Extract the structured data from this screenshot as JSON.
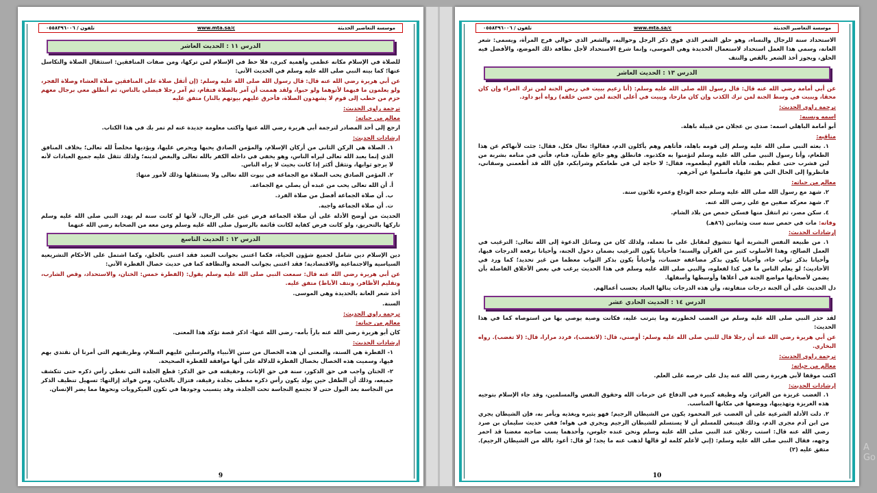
{
  "pages": {
    "left": {
      "header": {
        "org": "موسسة التعاضير الحديثة",
        "url": "www.mta.sa/c",
        "phone": "تلفون / ٠٥٥٨٣٩٦٠٠٦"
      },
      "page_number": "9",
      "lesson11": {
        "title": "الدرس ١١ : الحديث العاشر",
        "intro": "للصلاة في الإسلام مكانه عظمى وأهمية كبرى، فلا حظ في الإسلام لمن تركها، ومن صفات المنافقين: استثقال الصلاة والتكاسل عنها؛ كما بينه النبي صلى الله عليه وسلم في الحديث الآتي:",
        "hadith": "عن أبي هريرة رضي الله عنه قال: قال رسول الله صلى الله عليه وسلم: (إن أثقل صلاة على المنافقين صلاة العشاء وصلاة الفجر، ولو يعلمون ما فيهما لأتوهما ولو حبوا، ولقد هممت أن آمر بالصلاة فتقام، ثم آمر رجلا فيصلي بالناس، ثم أنطلق معي برجال معهم حزم من حطب إلى قوم لا يشهدون الصلاة، فأحرق عليهم بيوتهم بالنار) متفق عليه",
        "h_narrator": "ترجمة راوي الحديث:",
        "h_features": "معالم من حياته:",
        "features_text": "ارجع إلى أحد المصادر لترجمة أبي هريرة رضي الله عنها واكتب معلومة جديدة عنه لم تمر بك في هذا الكتاب.",
        "h_guidance": "إرشادات الحديث:",
        "g1": "١. الصلاة هي الركن الثاني من أركان الإسلام، والمؤمن الصادق يحبها ويحرص عليها، ويؤديها مخلصاً لله تعالى؛ بخلاف المنافق الذي إنما يعبد الله تعالى ليراه الناس، وهو يخفي في داخله الكفر بالله تعالى والبغض لدينه؛ ولذلك تثقل عليه جميع العبادات لأنه لا يرجو ثوابها، وتثقل أكثر إذا كانت بحيث لا يراه الناس.",
        "g2": "٢. المؤمن الصادق يحب الصلاة مع الجماعة في بيوت الله تعالى ولا يستثقلها وذلك لأمور منها:",
        "g2a": "أ. أن الله تعالى يحب من عبده أن يصلي مع الجماعة.",
        "g2b": "ب. أن صلاة الجماعة أفضل من صلاة الفرد.",
        "g2c": "ت. أن صلاة الجماعة واجبة.",
        "closing": "الحديث من أوضح الأدلة على أن صلاة الجماعة فرض عين على الرجال، لأنها لو كانت سنة لم يهدد النبي صلى الله عليه وسلم تاركها بالتحريق، ولو كانت فرض كفاية لكانت قائمة بالرسول صلى الله عليه وسلم ومن معه من الصحابة رضي الله عنهما"
      },
      "lesson12": {
        "title": "الدرس ١٢ : الحديث التاسع",
        "intro": "دين الإسلام دين شامل لجميع شؤون الحياة، فكما اعتنى بجوانب التعبد فقد اعتنى بالخلق، وكما اشتمل على الأحكام التشريعية السياسية والاجتماعية والاقتصادية؛ فقد اعتنى بجوانب الصحة والنظافة كما في حديث خصال الفطرة الآتي:",
        "hadith": "عن أبي هريرة رضي الله عنه قال: سمعت النبي صلى الله عليه وسلم يقول: (الفطرة خمس: الختان، والاستحداد، وقص الشارب، وتقليم الأظافر، ونتف الآباط) متفق عليه.",
        "def1": "أخذ شعر العانة بالحديدة وهي الموسى.",
        "def2": "السنة.",
        "h_narrator": "ترجمة راوي الحديث:",
        "h_features": "معالم من حياته:",
        "features_text": "كان أبو هريرة رضي الله عنه باراً بأمه- رضي الله عنها- اذكر قصة تؤكد هذا المعنى.",
        "h_guidance": "إرشادات الحديث:",
        "g1": "١- الفطرة هي السنة، والمعنى أن هذه الخصال من سنن الأنبياء والمرسلين عليهم السلام، وطريقتهم التي أمرنا أن نقتدي بهم فيها، وسميت هذه الخصال بخصال الفطرة للدلالة على أنها موافقة للفطرة الصحيحة.",
        "g2": "٢- الختان واجب في حق الذكور، سنة في حق الإناث، وحقيقته في حق الذكر: قطع الجلدة التي تغطي رأس ذكره حتى تتكشف جميعه، وذلك أن الطفل حين يولد يكون رأس ذكره مغطى بجلدة رقيقة، فتزال بالختان، ومن فوائد إزالتها: تسهيل تنظيف الذكر من النجاسة بعد البول حتى لا تجتمع النجاسة تحت الجلدة، وقد يتسبب وجودها في تكون الميكروبات ونحوها مما يضر الإنسان."
      }
    },
    "right": {
      "header": {
        "org": "موسسة التعاضير الحديثة",
        "url": "www.mta.sa/c",
        "phone": "تلفون / ٠٥٥٨٣٩٦٠٠٦"
      },
      "page_number": "10",
      "top_text": "الاستحداد سنة للرجال والنساء، وهو حلق الشعر الذي فوق ذكر الرجل وحواليه، والشعر الذي حوالي فرج المرأة، ويسمى: شعر العانة، وسمي هذا العمل استحداد لاستعمال الحديدة وهي الموسى، وإنما شرع الاستحداد لأجل نظافة ذلك الموضع، والأفضل فيه الحلق، ويجوز أخذ الشعر بالقص والنتف",
      "lesson13": {
        "title": "الدرس ١٣ : الحديث العاشر",
        "hadith": "عن أبي أمامة رضي الله عنه قال: قال رسول الله صلى الله عليه وسلم: (أنا زعيم ببيت في ربض الجنة لمن ترك المراء وإن كان محقا، وببيت في وسط الجنة لمن ترك الكذب وإن كان مازحا، وببيت في أعلى الجنة لمن حسن خلقه) رواه أبو داود.",
        "h_narrator": "ترجمة راوي الحديث:",
        "name_label": "اسمه ونسبه:",
        "name_text": "أبو أمامة الباهلي اسمه: صدي بن عجلان من قبيلة باهلة.",
        "virtues_label": "مناقبه:",
        "v1": "١. بعثه النبي صلى الله عليه وسلم إلى قومه باهلة، فأتاهم وهم يأكلون الدم، فقالوا: تعال فكل، فقال: جئت لأنهاكم عن هذا الطعام، وأنا رسول النبي صلى الله عليه وسلم لتؤمنوا به فكذبوه. فانطلق وهو جائع ظمآن، فنام، فأتي في منامه بشربة من لبن فشرب حتى عظم بطنه، فأتاه القوم ليطعموه، فقال: لا حاجة لي في طعامكم وشرابكم، فإن الله قد أطعمني وسقاني، فانظروا إلى الحال التي هو عليها، فأسلموا عن آخرهم.",
        "h_features": "معالم من حياته:",
        "v2": "٢. شهد مع رسول الله صلى الله عليه وسلم حجة الوداع وعمره ثلاثون سنة.",
        "v3": "٣. شهد معركة صفين مع علي رضي الله عنه.",
        "v4": "٤. سكن مصر، ثم انتقل منها فسكن حمص من بلاد الشام.",
        "death_label": "وفاته:",
        "death_text": "مات في حمص سنة ست وثمانين (٨٦هـ)",
        "h_guidance": "إرشادات الحديث:",
        "g1": "١. من طبيعة النفس البشرية أنها تتشوق لمقابل على ما تعمله، ولذلك كان من وسائل الدعوة إلى الله تعالى: الترغيب في العمل الصالح، وهذا الأسلوب كثير من القرآن والسنة؛ فأحيانا يكون الترغيب بضمان دخول الجنة، وأحيانا برفعة الدرجات فيها، وأحيانا بذكر ثواب خاء، وأحيانا يكون بذكر مضاعفة حسنات، وأحياناً يكون بذكر الثواب معظما من غير تحديد؛ كما ورد في الأحاديث؛ لو يعلم الناس ما في كذا لفعلوه، والنبي صلى الله عليه وسلم في هذا الحديث يرغب في بعض الأخلاق الفاضلة بأن يضمن لأصحابها مواضع الجنة في أعلاها وأوسطها وأسفلها.",
        "g1_end": "دل الحديث على أن الجنة درجات متفاوتة، وأن هذه الدرجات ينالها العباد بحسب أعمالهم."
      },
      "lesson14": {
        "title": "الدرس ١٤ : الحديث الحادي عشر",
        "intro": "لقد حذر النبي صلى الله عليه وسلم من الغضب لخطورته وما يترتب عليه، فكانت وصية يوصي بها من استوصاه كما في هذا الحديث:",
        "hadith": "عن أبي هريرة رضي الله عنه أن رجلا قال للنبي صلى الله عليه وسلم: أوصني، قال: (لاتغضب)، فردد مرارا، قال: (لا تغضب). رواه البخاري.",
        "h_narrator": "ترجمة راوي الحديث:",
        "h_features": "معالم من حياته:",
        "features_text": "اكتب موقفا لأبي هريرة رضي الله عنه يدل على حرصه على العلم.",
        "h_guidance": "إرشادات الحديث:",
        "g1": "١. الغضب غريزة من الغرائز، وله وظيفة كبيرة في الدفاع عن حرمات الله وحقوق النفس والمسلمين، وقد جاء الإسلام بتوجيه هذه الغريزة وتهذيبها، ووضعها في مكانها المناسب.",
        "g2": "٢. دلت الأدلة الشرعية على أن الغضب غير المحمود يكون من الشيطان الرجيم؛ فهو يثيره ويغذيه ويأمر به، فإن الشيطان يجري من ابن آدم مجرى الدم، وذلك فينبغي للمسلم أن لا يستسلم للشيطان الرجيم ويجري في هواه؛ ففي حديث سليمان بن صرد رضي الله عنه قال: استب رجلان عند النبي صلى الله عليه وسلم ونحن عنده جلوس، وأحدهما يسب صاحبه مغضبا قد احمر وجهه، فقال النبي صلى الله عليه وسلم: (إني لأعلم كلمة لو قالها لذهب عنه ما يجد؛ لو قال: أعوذ بالله من الشيطان الرجيم). متفق عليه (٢)"
      }
    }
  },
  "watermark": "A\nGo"
}
